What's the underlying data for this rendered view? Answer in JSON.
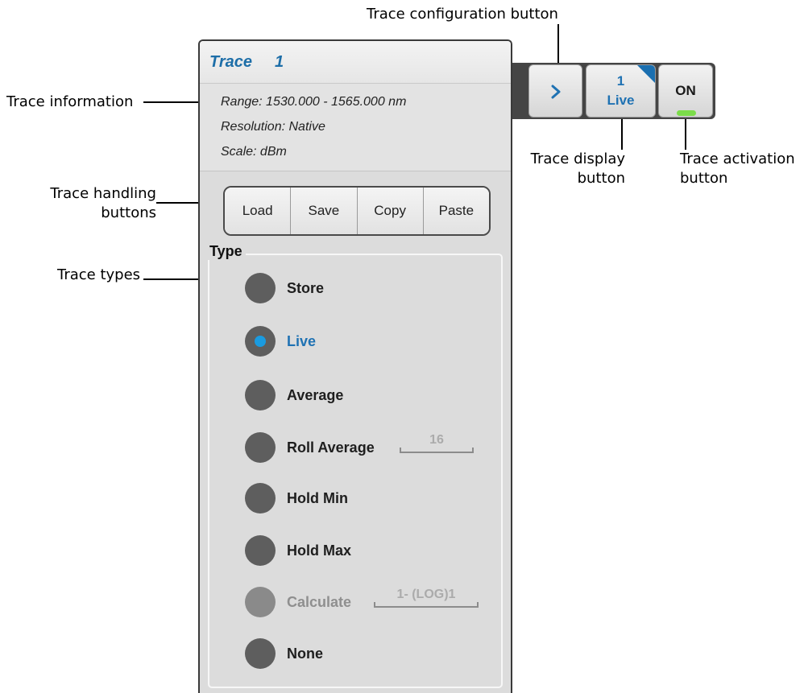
{
  "callouts": {
    "trace_config_button": "Trace configuration button",
    "trace_information": "Trace information",
    "trace_handling_line1": "Trace handling",
    "trace_handling_line2": "buttons",
    "trace_types": "Trace types",
    "trace_display_line1": "Trace display",
    "trace_display_line2": "button",
    "trace_activation_line1": "Trace activation",
    "trace_activation_line2": "button"
  },
  "panel": {
    "title": "Trace",
    "trace_number": "1",
    "info": {
      "range": "Range: 1530.000 - 1565.000 nm",
      "resolution": "Resolution: Native",
      "scale": "Scale: dBm"
    },
    "handling_buttons": {
      "load": "Load",
      "save": "Save",
      "copy": "Copy",
      "paste": "Paste"
    },
    "type_group_label": "Type",
    "types": [
      {
        "label": "Store",
        "selected": false,
        "enabled": true
      },
      {
        "label": "Live",
        "selected": true,
        "enabled": true
      },
      {
        "label": "Average",
        "selected": false,
        "enabled": true
      },
      {
        "label": "Roll Average",
        "selected": false,
        "enabled": true,
        "param": "16"
      },
      {
        "label": "Hold Min",
        "selected": false,
        "enabled": true
      },
      {
        "label": "Hold Max",
        "selected": false,
        "enabled": true
      },
      {
        "label": "Calculate",
        "selected": false,
        "enabled": false,
        "param": "1- (LOG)1"
      },
      {
        "label": "None",
        "selected": false,
        "enabled": true
      }
    ]
  },
  "controls": {
    "config_icon": "chevron-right-icon",
    "display_trace_number": "1",
    "display_trace_type": "Live",
    "activation_label": "ON",
    "activation_state": "on"
  },
  "colors": {
    "accent_blue": "#1f72b3",
    "selected_dot": "#1a9be0",
    "led_green": "#7bdc4a"
  }
}
